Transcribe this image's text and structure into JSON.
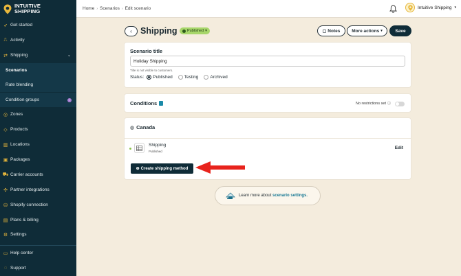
{
  "brand": {
    "line1": "INTUITIVE",
    "line2": "SHIPPING"
  },
  "sidebar": {
    "items": [
      {
        "label": "Get started",
        "icon": "rocket-icon"
      },
      {
        "label": "Activity",
        "icon": "activity-icon"
      },
      {
        "label": "Shipping",
        "icon": "shipping-icon"
      },
      {
        "label": "Scenarios",
        "icon": ""
      },
      {
        "label": "Rate blending",
        "icon": ""
      },
      {
        "label": "Condition groups",
        "icon": ""
      },
      {
        "label": "Zones",
        "icon": "zones-icon"
      },
      {
        "label": "Products",
        "icon": "products-icon"
      },
      {
        "label": "Locations",
        "icon": "locations-icon"
      },
      {
        "label": "Packages",
        "icon": "packages-icon"
      },
      {
        "label": "Carrier accounts",
        "icon": "carrier-icon"
      },
      {
        "label": "Partner integrations",
        "icon": "partner-icon"
      },
      {
        "label": "Shopify connection",
        "icon": "shopify-icon"
      },
      {
        "label": "Plans & billing",
        "icon": "billing-icon"
      },
      {
        "label": "Settings",
        "icon": "gear-icon"
      }
    ],
    "bottom": [
      {
        "label": "Help center",
        "icon": "help-icon"
      },
      {
        "label": "Support",
        "icon": "support-icon"
      }
    ],
    "condition_groups_badge": "i"
  },
  "breadcrumb": {
    "home": "Home",
    "scenarios": "Scenarios",
    "current": "Edit scenario"
  },
  "user": {
    "name": "Intuitive Shipping"
  },
  "header": {
    "title": "Shipping",
    "status_badge": "Published",
    "notes_label": "Notes",
    "more_actions_label": "More actions",
    "save_label": "Save"
  },
  "scenario": {
    "section_title": "Scenario title",
    "title_value": "Holiday Shipping",
    "help_text": "Title is not visible to customers.",
    "status_label": "Status:",
    "options": [
      "Published",
      "Testing",
      "Archived"
    ],
    "selected": "Published"
  },
  "conditions": {
    "title": "Conditions",
    "restriction_text": "No restrictions set"
  },
  "zone": {
    "title": "Canada",
    "method_name": "Shipping",
    "method_status": "Published",
    "edit_label": "Edit",
    "create_label": "Create shipping method"
  },
  "learn_more": {
    "prefix": "Learn more about",
    "link": "scenario settings."
  },
  "colors": {
    "sidebar_bg": "#0f2c38",
    "accent_yellow": "#e8b73c",
    "published_green": "#a7d66a",
    "arrow_red": "#e8231c",
    "page_bg": "#f4ecdd"
  }
}
